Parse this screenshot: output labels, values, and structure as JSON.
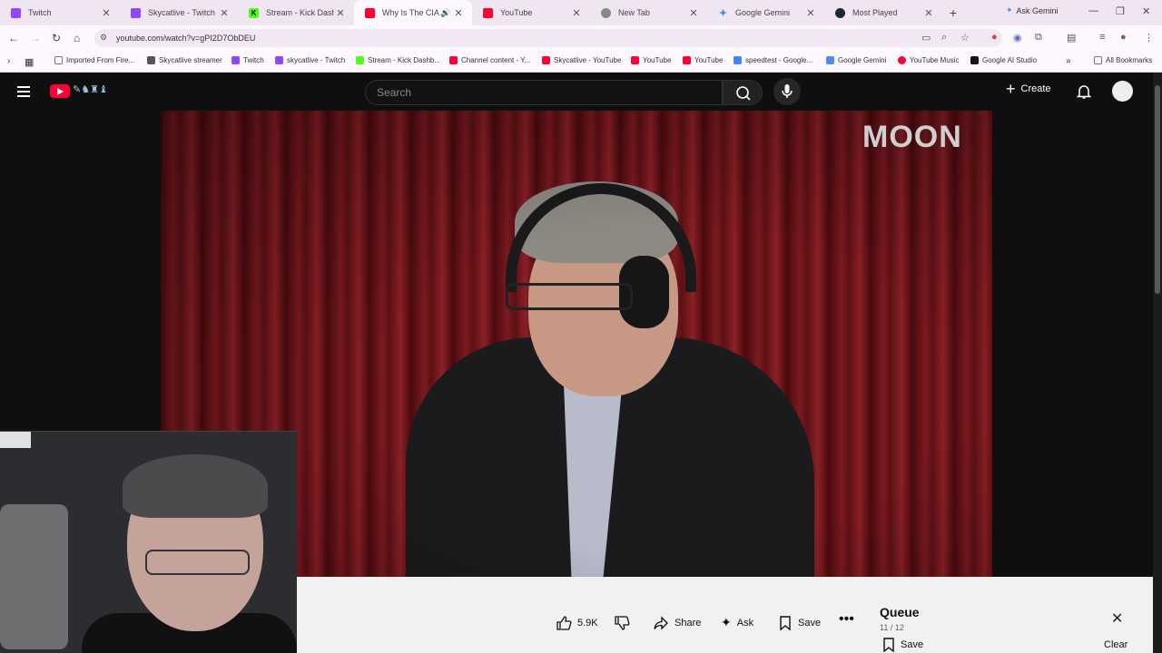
{
  "browser": {
    "tabs": [
      {
        "title": "Twitch",
        "fav_color": "#9146ff",
        "active": false
      },
      {
        "title": "Skycatlive - Twitch",
        "fav_color": "#9146ff",
        "active": false
      },
      {
        "title": "Stream - Kick Dashboard",
        "fav_color": "#53fc18",
        "active": false
      },
      {
        "title": "Why Is The CIA Co...",
        "fav_color": "#ff0033",
        "active": true
      },
      {
        "title": "YouTube",
        "fav_color": "#ff0033",
        "active": false
      },
      {
        "title": "New Tab",
        "fav_color": "#888888",
        "active": false
      },
      {
        "title": "Google Gemini",
        "fav_color": "#4c8bf5",
        "active": false
      },
      {
        "title": "Most Played",
        "fav_color": "#1b2838",
        "active": false
      }
    ],
    "ask_gemini": "Ask Gemini",
    "url": "youtube.com/watch?v=gPI2D7ObDEU",
    "bookmarks": [
      {
        "label": "Imported From Fire...",
        "color": "#777777"
      },
      {
        "label": "Skycatlive streamer",
        "color": "#555555"
      },
      {
        "label": "Twitch",
        "color": "#9146ff"
      },
      {
        "label": "skycatlive - Twitch",
        "color": "#9146ff"
      },
      {
        "label": "Stream - Kick Dashb...",
        "color": "#53fc18"
      },
      {
        "label": "Channel content - Y...",
        "color": "#ff0033"
      },
      {
        "label": "Skycatlive - YouTube",
        "color": "#ff0033"
      },
      {
        "label": "YouTube",
        "color": "#ff0033"
      },
      {
        "label": "YouTube",
        "color": "#ff0033"
      },
      {
        "label": "speedtest - Google...",
        "color": "#4285f4"
      },
      {
        "label": "Google Gemini",
        "color": "#4c8bf5"
      },
      {
        "label": "YouTube Music",
        "color": "#ff0033"
      },
      {
        "label": "Google AI Studio",
        "color": "#111111"
      }
    ],
    "all_bookmarks": "All Bookmarks"
  },
  "youtube": {
    "search_placeholder": "Search",
    "create_label": "Create",
    "watermark": "MOON",
    "actions": {
      "likes": "5.9K",
      "share": "Share",
      "ask": "Ask",
      "save": "Save"
    },
    "queue": {
      "title": "Queue",
      "count": "11 / 12",
      "save": "Save",
      "clear": "Clear"
    }
  }
}
